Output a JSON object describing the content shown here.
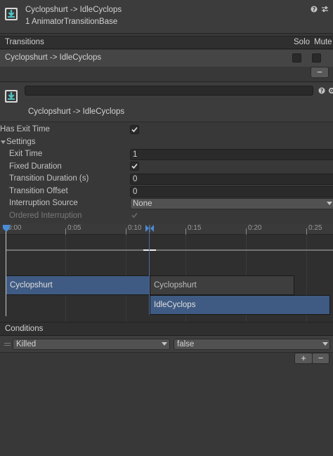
{
  "header": {
    "title": "Cyclopshurt -> IdleCyclops",
    "subtitle": "1 AnimatorTransitionBase",
    "icon": "transition-arrow-icon",
    "help_icon": "help-icon",
    "settings_icon": "preset-settings-icon"
  },
  "transitions_list": {
    "header_label": "Transitions",
    "solo_label": "Solo",
    "mute_label": "Mute",
    "rows": [
      {
        "name": "Cyclopshurt -> IdleCyclops",
        "solo": false,
        "mute": false
      }
    ],
    "remove_label": "−"
  },
  "transition": {
    "name_field_value": "",
    "display_name": "Cyclopshurt -> IdleCyclops",
    "icon": "transition-arrow-icon",
    "help_icon": "help-icon",
    "gear_icon": "gear-icon"
  },
  "properties": {
    "has_exit_time_label": "Has Exit Time",
    "has_exit_time": true,
    "settings_label": "Settings",
    "exit_time_label": "Exit Time",
    "exit_time_value": "1",
    "fixed_duration_label": "Fixed Duration",
    "fixed_duration": true,
    "transition_duration_label": "Transition Duration (s)",
    "transition_duration_value": "0",
    "transition_offset_label": "Transition Offset",
    "transition_offset_value": "0",
    "interruption_source_label": "Interruption Source",
    "interruption_source_value": "None",
    "ordered_interruption_label": "Ordered Interruption",
    "ordered_interruption": true
  },
  "timeline": {
    "ticks": [
      "0:00",
      "0:05",
      "0:10",
      "0:15",
      "0:20",
      "0:25"
    ],
    "clips": {
      "source_top": "Cyclopshurt",
      "source_continuation": "Cyclopshurt",
      "destination": "IdleCyclops"
    }
  },
  "conditions": {
    "header_label": "Conditions",
    "rows": [
      {
        "parameter": "Killed",
        "value": "false"
      }
    ],
    "add_label": "+",
    "remove_label": "−"
  },
  "colors": {
    "background": "#383838",
    "clip_blue": "#3f5b83",
    "clip_gray": "#3e3e3e",
    "marker_blue": "#4d8cd6"
  }
}
